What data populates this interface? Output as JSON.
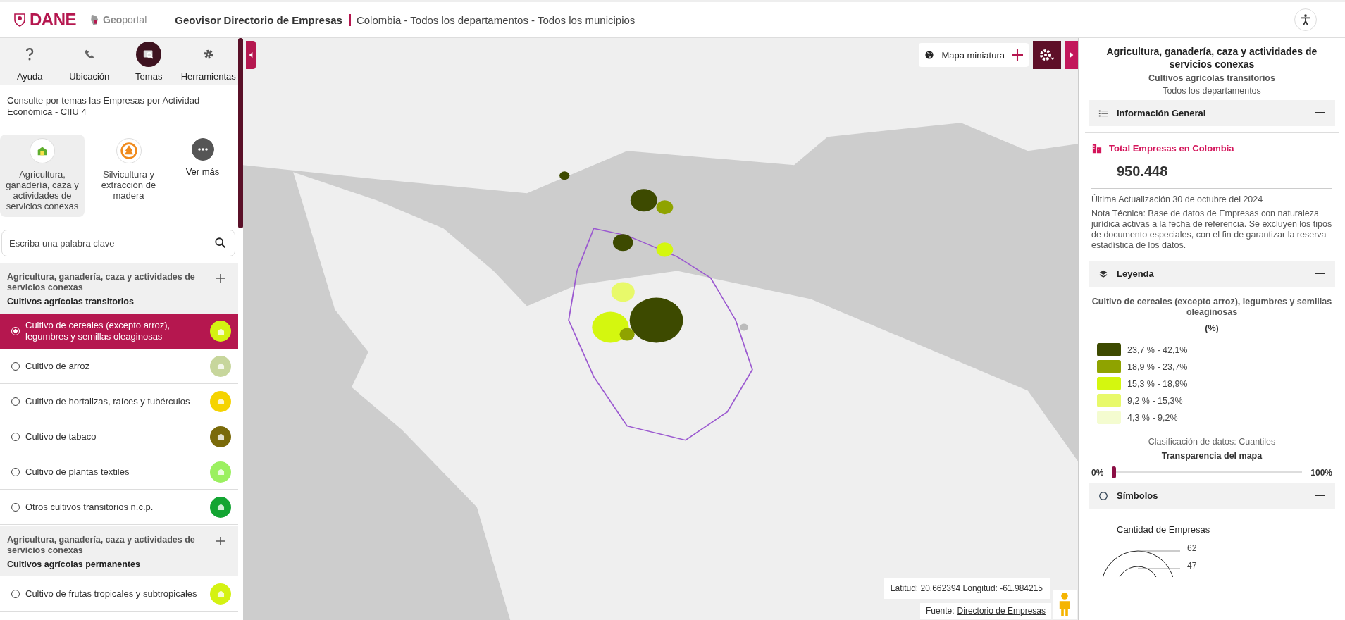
{
  "header": {
    "logo": "DANE",
    "geoportal": "**Geo**portal",
    "title": "Geovisor Directorio de Empresas",
    "location": "Colombia - Todos los departamentos - Todos los municipios"
  },
  "toolbar": [
    {
      "label": "Ayuda",
      "kind": "help",
      "selected": false
    },
    {
      "label": "Ubicación",
      "kind": "location",
      "selected": false
    },
    {
      "label": "Temas",
      "kind": "themes",
      "selected": true
    },
    {
      "label": "Herramientas",
      "kind": "tools",
      "selected": false
    }
  ],
  "intro": "Consulte por temas las Empresas por Actividad Económica - CIIU 4",
  "themes": [
    {
      "label": "Agricultura, ganadería, caza y actividades de servicios conexas",
      "kind": "agri",
      "selected": true
    },
    {
      "label": "Silvicultura y extracción de madera",
      "kind": "forest",
      "selected": false
    },
    {
      "label": "Ver más",
      "kind": "more",
      "selected": false
    }
  ],
  "search": {
    "placeholder": "Escriba una palabra clave"
  },
  "groups": [
    {
      "sector": "Agricultura, ganadería, caza y actividades de servicios conexas",
      "title": "Cultivos agrícolas transitorios",
      "items": [
        {
          "label": "Cultivo de cereales (excepto arroz), legumbres y semillas oleaginosas",
          "selected": true,
          "color": "#d4f212"
        },
        {
          "label": "Cultivo de arroz",
          "selected": false,
          "color": "#c7d69c"
        },
        {
          "label": "Cultivo de hortalizas, raíces y tubérculos",
          "selected": false,
          "color": "#f5d300"
        },
        {
          "label": "Cultivo de tabaco",
          "selected": false,
          "color": "#7a6a0a"
        },
        {
          "label": "Cultivo de plantas textiles",
          "selected": false,
          "color": "#9bf060"
        },
        {
          "label": "Otros cultivos transitorios n.c.p.",
          "selected": false,
          "color": "#13a532"
        }
      ]
    },
    {
      "sector": "Agricultura, ganadería, caza y actividades de servicios conexas",
      "title": "Cultivos agrícolas permanentes",
      "items": [
        {
          "label": "Cultivo de frutas tropicales y subtropicales",
          "selected": false,
          "color": "#d4f212"
        }
      ]
    }
  ],
  "map": {
    "minimap": "Mapa miniatura",
    "coords": "Latitud: 20.662394 Longitud: -61.984215",
    "source_label": "Fuente:",
    "source_link": "Directorio de Empresas"
  },
  "panel": {
    "title": "Agricultura, ganadería, caza y actividades de servicios conexas",
    "subtitle": "Cultivos agrícolas transitorios",
    "scope": "Todos los departamentos",
    "info_heading": "Información General",
    "total_label": "Total Empresas en Colombia",
    "total": "950.448",
    "updated": "Última Actualización 30 de octubre del 2024",
    "note": "Nota Técnica: Base de datos de Empresas con naturaleza jurídica activas a la fecha de referencia. Se excluyen los tipos de documento especiales, con el fin de garantizar la reserva estadística de los datos.",
    "legend_heading": "Leyenda",
    "legend_title": "Cultivo de cereales (excepto arroz), legumbres y semillas oleaginosas",
    "legend_unit": "(%)",
    "classes": [
      {
        "label": "23,7 % - 42,1%",
        "color": "#3d4a00"
      },
      {
        "label": "18,9 % - 23,7%",
        "color": "#8fa300"
      },
      {
        "label": "15,3 % - 18,9%",
        "color": "#d4f70f"
      },
      {
        "label": "9,2 % - 15,3%",
        "color": "#e8f96a"
      },
      {
        "label": "4,3 % - 9,2%",
        "color": "#f4fcd0"
      }
    ],
    "classification": "Clasificación de datos: Cuantiles",
    "transparency_label": "Transparencia del mapa",
    "transparency": {
      "min": "0%",
      "max": "100%",
      "level": 0
    },
    "symbols_heading": "Símbolos",
    "symbols_title": "Cantidad de Empresas",
    "symbol_values": [
      "62",
      "47"
    ]
  }
}
